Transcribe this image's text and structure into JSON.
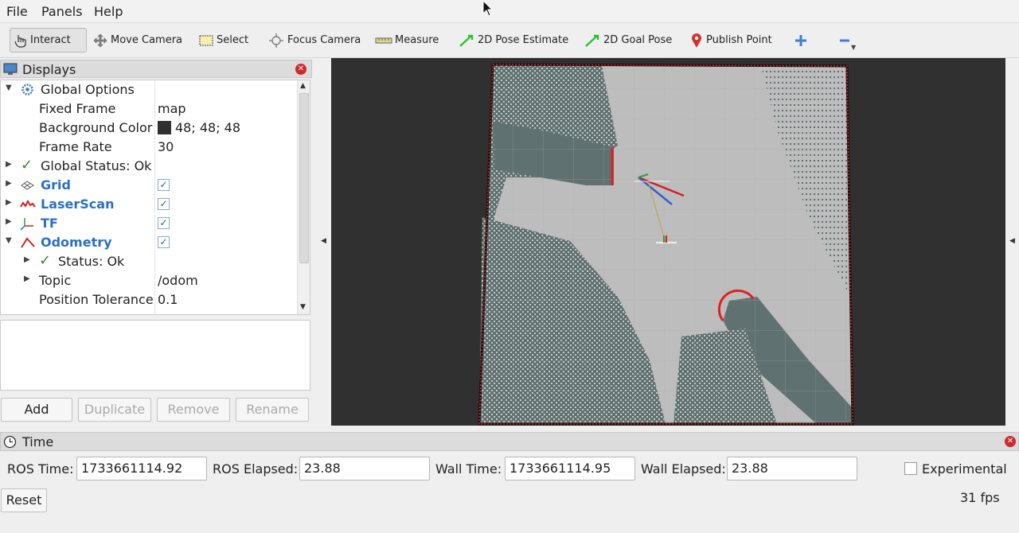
{
  "menu": {
    "file": "File",
    "panels": "Panels",
    "help": "Help"
  },
  "toolbar": {
    "interact": "Interact",
    "move_camera": "Move Camera",
    "select": "Select",
    "focus_camera": "Focus Camera",
    "measure": "Measure",
    "pose_estimate": "2D Pose Estimate",
    "goal_pose": "2D Goal Pose",
    "publish_point": "Publish Point"
  },
  "displays": {
    "title": "Displays",
    "rows": {
      "global_options": "Global Options",
      "fixed_frame_label": "Fixed Frame",
      "fixed_frame_value": "map",
      "bg_color_label": "Background Color",
      "bg_color_value": "48; 48; 48",
      "frame_rate_label": "Frame Rate",
      "frame_rate_value": "30",
      "global_status": "Global Status: Ok",
      "grid": "Grid",
      "laserscan": "LaserScan",
      "tf": "TF",
      "odometry": "Odometry",
      "status_ok": "Status: Ok",
      "topic_label": "Topic",
      "topic_value": "/odom",
      "pos_tol_label": "Position Tolerance",
      "pos_tol_value": "0.1"
    },
    "buttons": {
      "add": "Add",
      "duplicate": "Duplicate",
      "remove": "Remove",
      "rename": "Rename"
    }
  },
  "time": {
    "title": "Time",
    "ros_time_label": "ROS Time:",
    "ros_time_value": "1733661114.92",
    "ros_elapsed_label": "ROS Elapsed:",
    "ros_elapsed_value": "23.88",
    "wall_time_label": "Wall Time:",
    "wall_time_value": "1733661114.95",
    "wall_elapsed_label": "Wall Elapsed:",
    "wall_elapsed_value": "23.88",
    "experimental": "Experimental",
    "reset": "Reset",
    "fps": "31 fps"
  },
  "colors": {
    "background": "#303030",
    "map_free": "#bdbdbd",
    "map_unknown": "#5f7170",
    "laser": "#e02020"
  }
}
